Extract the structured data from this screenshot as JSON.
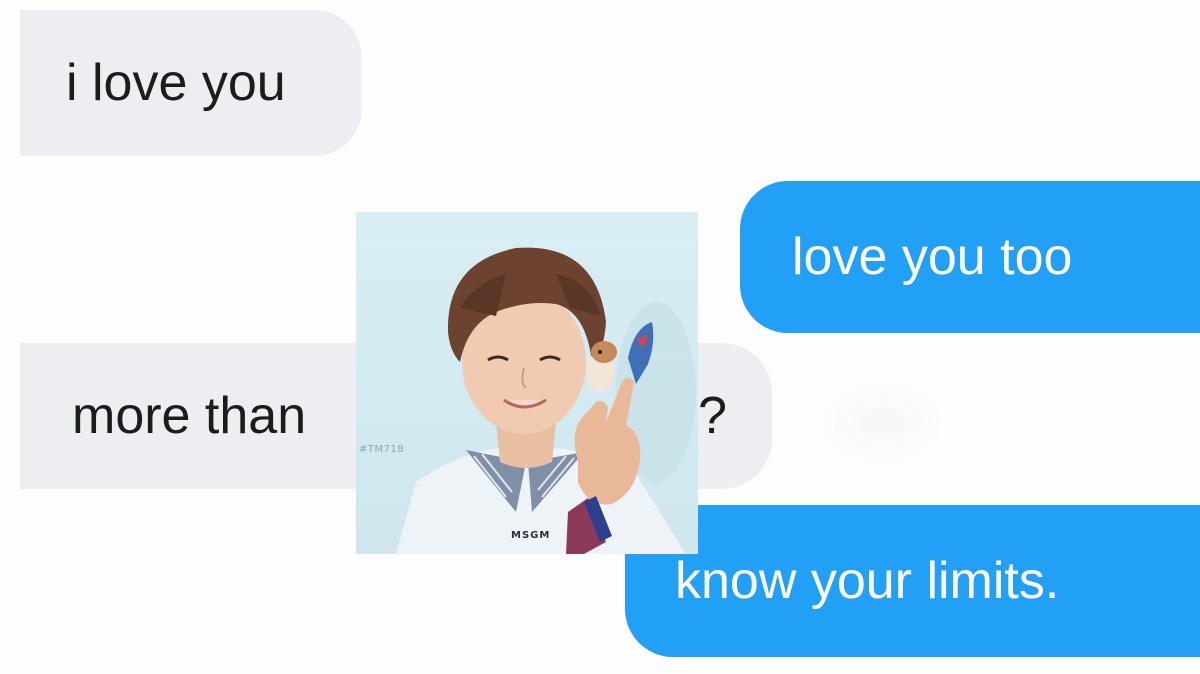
{
  "conversation": {
    "messages": [
      {
        "side": "received",
        "text": "i love you"
      },
      {
        "side": "sent",
        "text": "love you too"
      },
      {
        "side": "received",
        "text_before": "more than",
        "text_after": "?"
      },
      {
        "side": "sent",
        "text": "know your limits."
      }
    ]
  },
  "photo": {
    "watermark": "#TM718",
    "shirt_logo": "MSGM"
  },
  "colors": {
    "received_bubble": "#eceef2",
    "sent_bubble": "#21a0f5",
    "received_text": "#1c1c1c",
    "sent_text": "#ffffff"
  }
}
